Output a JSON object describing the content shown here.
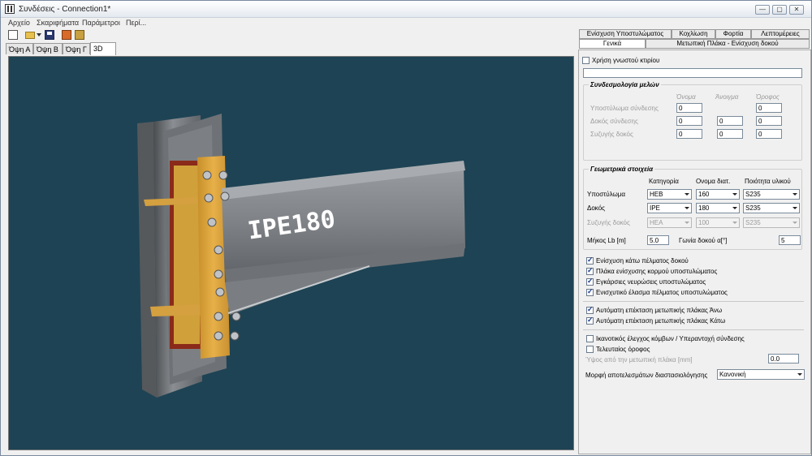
{
  "window": {
    "title": "Συνδέσεις - Connection1*",
    "min": "—",
    "max": "▢",
    "close": "✕"
  },
  "menu": [
    "Αρχείο",
    "Σκαριφήματα",
    "Παράμετροι",
    "Περί..."
  ],
  "view_tabs": [
    "Όψη Α",
    "Όψη Β",
    "Όψη Γ",
    "3D"
  ],
  "viewport": {
    "beam_label": "IPE180",
    "background": "#1e4354"
  },
  "right_tabs_top": [
    "Ενίσχυση Υποστυλώματος",
    "Κοχλίωση",
    "Φορτία",
    "Λεπτομέρειες"
  ],
  "right_tabs_bottom": [
    "Γενικά",
    "Μετωπική Πλάκα - Ενίσχυση δοκού"
  ],
  "general": {
    "known_building_label": "Χρήση γνωστού κτιρίου",
    "known_building_value": "",
    "members_group": {
      "title": "Συνδεσμολογία μελών",
      "col_name": "Όνομα",
      "col_opening": "Άνοιγμα",
      "col_floor": "Όροφος",
      "rows": [
        {
          "label": "Υποστύλωμα σύνδεσης",
          "name": "0",
          "opening": "",
          "floor": "0"
        },
        {
          "label": "Δοκός σύνδεσης",
          "name": "0",
          "opening": "0",
          "floor": "0"
        },
        {
          "label": "Συζυγής δοκός",
          "name": "0",
          "opening": "0",
          "floor": "0"
        }
      ]
    },
    "geometry_group": {
      "title": "Γεωμετρικά στοιχεία",
      "col_category": "Κατηγορία",
      "col_section": "Ονομα διατ.",
      "col_material": "Ποιότητα υλικού",
      "rows": [
        {
          "label": "Υποστύλωμα",
          "category": "HEB",
          "section": "160",
          "material": "S235",
          "disabled": false
        },
        {
          "label": "Δοκός",
          "category": "IPE",
          "section": "180",
          "material": "S235",
          "disabled": false
        },
        {
          "label": "Συζυγής δοκός",
          "category": "HEA",
          "section": "100",
          "material": "S235",
          "disabled": true
        }
      ],
      "length_label": "Μήκος Lb [m]",
      "length_value": "5.0",
      "angle_label": "Γωνία δοκού α[°]",
      "angle_value": "5"
    },
    "checks": [
      {
        "label": "Ενίσχυση κάτω πέλματος δοκού",
        "checked": true
      },
      {
        "label": "Πλάκα ενίσχυσης κορμού υποστυλώματος",
        "checked": true
      },
      {
        "label": "Εγκάρσιες νευρώσεις υποστυλώματος",
        "checked": true
      },
      {
        "label": "Ενισχυτικό έλασμα πέλματος υποστυλώματος",
        "checked": true
      },
      {
        "label": "Αυτόματη επέκταση μετωπικής πλάκας Άνω",
        "checked": true
      },
      {
        "label": "Αυτόματη επέκταση μετωπικής πλάκας Κάτω",
        "checked": true
      },
      {
        "label": "Ικανοτικός έλεγχος κόμβων / Υπεραντοχή σύνδεσης",
        "checked": false
      },
      {
        "label": "Τελευταίος όροφος",
        "checked": false
      }
    ],
    "height_label": "Ύψος από την μετωπική πλάκα [mm]",
    "height_value": "0.0",
    "results_label": "Μορφή αποτελεσμάτων διαστασιολόγησης",
    "results_value": "Κανονική"
  }
}
